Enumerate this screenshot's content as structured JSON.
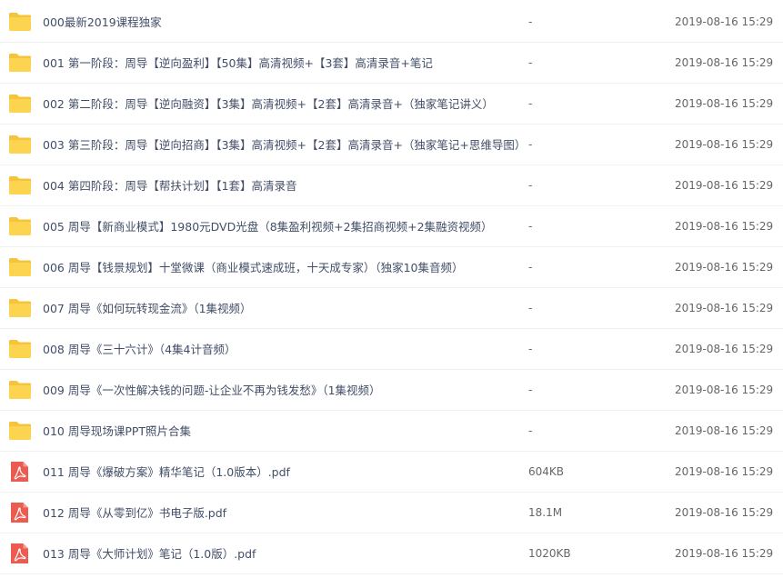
{
  "files": [
    {
      "icon": "folder-icon",
      "name": "000最新2019课程独家",
      "size": "-",
      "date": "2019-08-16 15:29"
    },
    {
      "icon": "folder-icon",
      "name": "001 第一阶段：周导【逆向盈利】【50集】高清视频+【3套】高清录音+笔记",
      "size": "-",
      "date": "2019-08-16 15:29"
    },
    {
      "icon": "folder-icon",
      "name": "002 第二阶段：周导【逆向融资】【3集】高清视频+【2套】高清录音+（独家笔记讲义）",
      "size": "-",
      "date": "2019-08-16 15:29"
    },
    {
      "icon": "folder-icon",
      "name": "003 第三阶段：周导【逆向招商】【3集】高清视频+【2套】高清录音+（独家笔记+思维导图）",
      "size": "-",
      "date": "2019-08-16 15:29"
    },
    {
      "icon": "folder-icon",
      "name": "004 第四阶段：周导【帮扶计划】【1套】高清录音",
      "size": "-",
      "date": "2019-08-16 15:29"
    },
    {
      "icon": "folder-icon",
      "name": "005 周导【新商业模式】1980元DVD光盘（8集盈利视频+2集招商视频+2集融资视频）",
      "size": "-",
      "date": "2019-08-16 15:29"
    },
    {
      "icon": "folder-icon",
      "name": "006 周导【钱景规划】十堂微课（商业模式速成班，十天成专家）（独家10集音频）",
      "size": "-",
      "date": "2019-08-16 15:29"
    },
    {
      "icon": "folder-icon",
      "name": "007 周导《如何玩转现金流》（1集视频）",
      "size": "-",
      "date": "2019-08-16 15:29"
    },
    {
      "icon": "folder-icon",
      "name": "008 周导《三十六计》（4集4计音频）",
      "size": "-",
      "date": "2019-08-16 15:29"
    },
    {
      "icon": "folder-icon",
      "name": "009 周导《一次性解决钱的问题-让企业不再为钱发愁》（1集视频）",
      "size": "-",
      "date": "2019-08-16 15:29"
    },
    {
      "icon": "folder-icon",
      "name": "010 周导现场课PPT照片合集",
      "size": "-",
      "date": "2019-08-16 15:29"
    },
    {
      "icon": "pdf-icon",
      "name": "011 周导《爆破方案》精华笔记（1.0版本）.pdf",
      "size": "604KB",
      "date": "2019-08-16 15:29"
    },
    {
      "icon": "pdf-icon",
      "name": "012 周导《从零到亿》书电子版.pdf",
      "size": "18.1M",
      "date": "2019-08-16 15:29"
    },
    {
      "icon": "pdf-icon",
      "name": "013 周导《大师计划》笔记（1.0版）.pdf",
      "size": "1020KB",
      "date": "2019-08-16 15:29"
    }
  ],
  "colors": {
    "folder_back": "#f5c43b",
    "folder_front": "#fcd450",
    "pdf_red": "#ec5b4f",
    "text_primary": "#424e67",
    "text_secondary": "#666666",
    "row_divider": "#f1f2f4"
  }
}
